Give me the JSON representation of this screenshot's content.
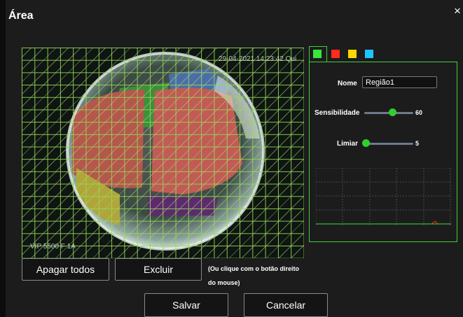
{
  "dialog": {
    "title": "Área",
    "close_glyph": "×"
  },
  "video": {
    "timestamp": "29-04-2021 14:23:42 Qui",
    "camera_label": "VIP 5500 F 1A"
  },
  "color_tabs": [
    {
      "color": "#39e639",
      "active": true
    },
    {
      "color": "#ff2b1c",
      "active": false
    },
    {
      "color": "#ffd800",
      "active": false
    },
    {
      "color": "#1cc6ff",
      "active": false
    }
  ],
  "settings": {
    "name_label": "Nome",
    "name_value": "Região1",
    "sensitivity_label": "Sensibilidade",
    "sensitivity_value": "60",
    "threshold_label": "Limiar",
    "threshold_value": "5"
  },
  "buttons": {
    "clear_all": "Apagar todos",
    "delete": "Excluir",
    "delete_hint_line1": "(Ou clique com o botão direito",
    "delete_hint_line2": "do mouse)",
    "save": "Salvar",
    "cancel": "Cancelar"
  },
  "colors": {
    "accent": "#3fcf3f",
    "grid": "#96d75a"
  }
}
